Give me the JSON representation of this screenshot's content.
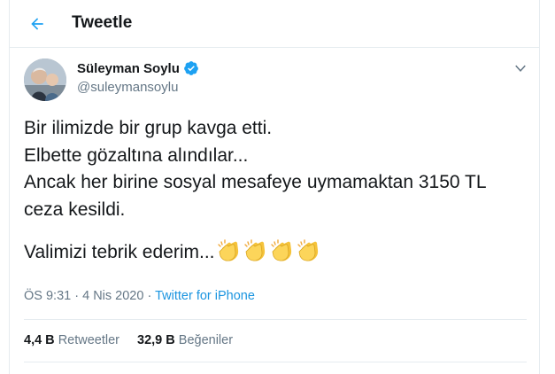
{
  "header": {
    "title": "Tweetle",
    "back_icon": "arrow-left-icon"
  },
  "author": {
    "name": "Süleyman Soylu",
    "handle": "@suleymansoylu",
    "verified": true
  },
  "tweet": {
    "lines": [
      "Bir ilimizde bir grup kavga etti.",
      "Elbette gözaltına alındılar...",
      "Ancak her birine sosyal mesafeye uymamaktan 3150 TL",
      "ceza kesildi."
    ],
    "closing": "Valimizi tebrik ederim...",
    "emoji": "clapping-hands-icon",
    "emoji_count": 4
  },
  "meta": {
    "time": "ÖS 9:31",
    "separator": "·",
    "date": "4 Nis 2020",
    "source": "Twitter for iPhone"
  },
  "stats": {
    "retweets_count": "4,4 B",
    "retweets_label": "Retweetler",
    "likes_count": "32,9 B",
    "likes_label": "Beğeniler"
  },
  "colors": {
    "accent": "#1da1f2",
    "text": "#14171a",
    "muted": "#657786",
    "border": "#e6ecf0",
    "clap": "#f5c33b"
  }
}
